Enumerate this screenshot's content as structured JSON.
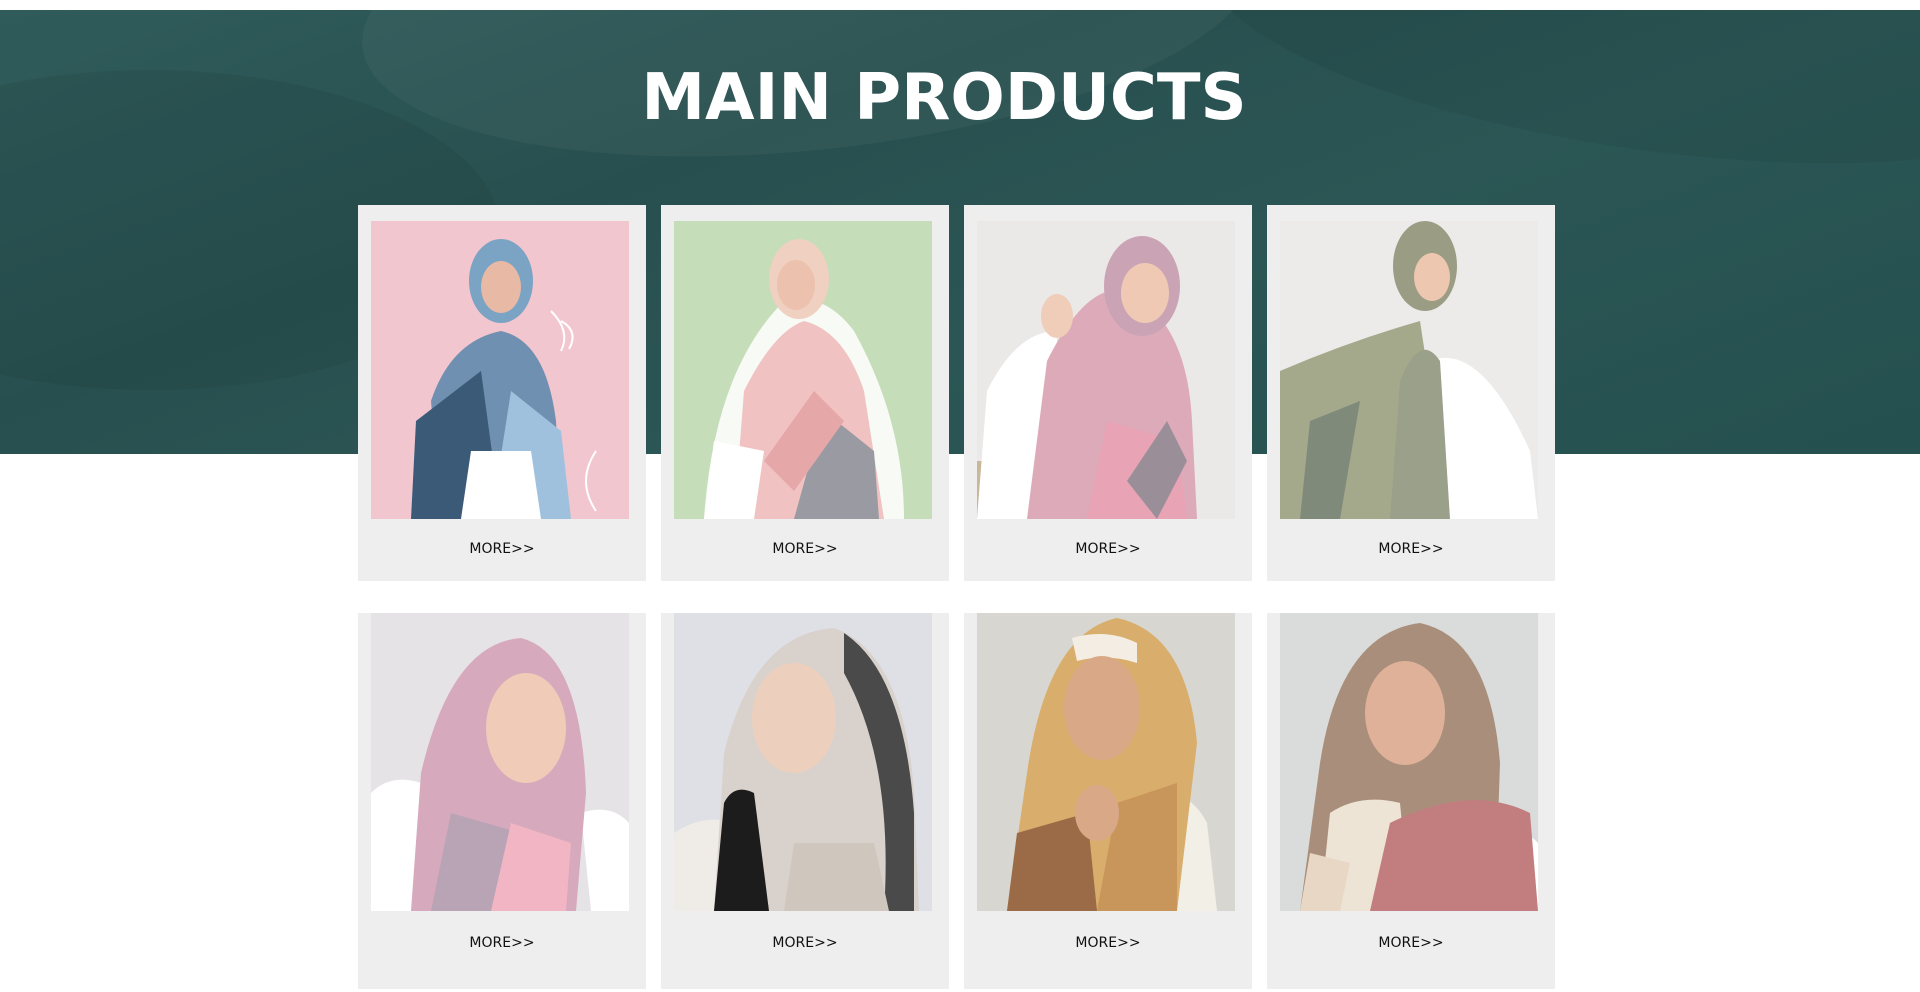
{
  "section": {
    "title": "MAIN PRODUCTS"
  },
  "colors": {
    "banner": "#2b5655",
    "card_background": "#eeeeee",
    "title_text": "#ffffff"
  },
  "products": [
    {
      "more_label": "MORE>>",
      "image": "model-in-blue-pink-patterned-hijab"
    },
    {
      "more_label": "MORE>>",
      "image": "model-in-pink-grey-geometric-hijab"
    },
    {
      "more_label": "MORE>>",
      "image": "model-in-pink-grey-plaid-hijab"
    },
    {
      "more_label": "MORE>>",
      "image": "model-in-sage-green-hijab"
    },
    {
      "more_label": "MORE>>",
      "image": "model-in-pink-lilac-hijab"
    },
    {
      "more_label": "MORE>>",
      "image": "model-in-black-beige-ombre-hijab"
    },
    {
      "more_label": "MORE>>",
      "image": "model-in-mustard-brown-ombre-hijab"
    },
    {
      "more_label": "MORE>>",
      "image": "model-in-taupe-rose-ombre-hijab"
    }
  ]
}
